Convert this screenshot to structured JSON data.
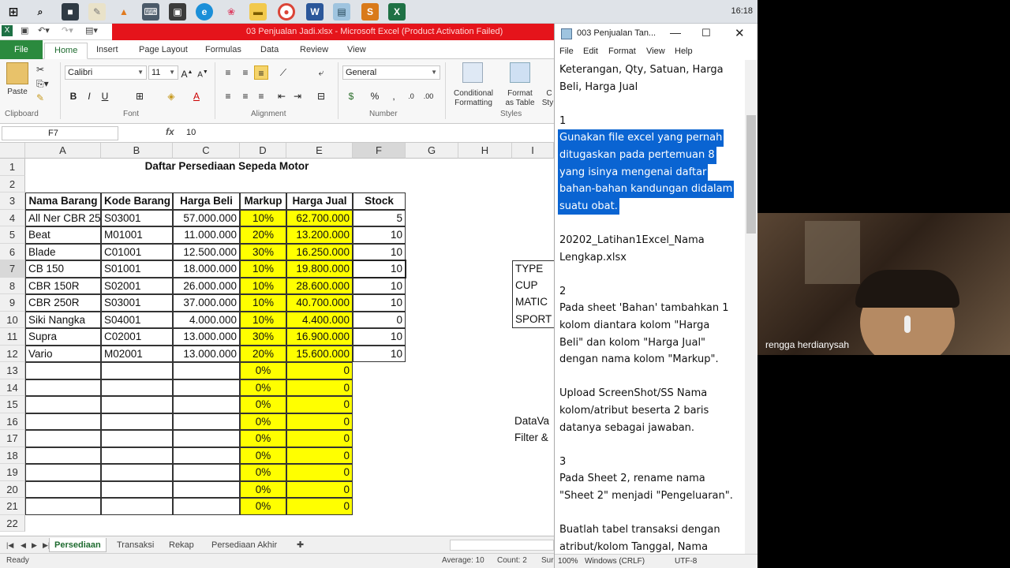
{
  "taskbar": {
    "clock": "16:18"
  },
  "excel": {
    "title": "03 Penjualan Jadi.xlsx  -  Microsoft Excel (Product Activation Failed)",
    "tabs": [
      "File",
      "Home",
      "Insert",
      "Page Layout",
      "Formulas",
      "Data",
      "Review",
      "View"
    ],
    "active_tab": "Home",
    "ribbon": {
      "paste_label": "Paste",
      "clipboard_label": "Clipboard",
      "font_name": "Calibri",
      "font_size": "11",
      "font_label": "Font",
      "alignment_label": "Alignment",
      "number_format": "General",
      "number_label": "Number",
      "conditional_formatting": "Conditional",
      "conditional_formatting_2": "Formatting",
      "format_as_table": "Format",
      "format_as_table_2": "as Table",
      "cell_styles": "C",
      "cell_styles_2": "Sty",
      "styles_label": "Styles"
    },
    "formula_bar": {
      "name_box": "F7",
      "fx": "fx",
      "value": "10"
    },
    "columns": [
      "A",
      "B",
      "C",
      "D",
      "E",
      "F",
      "G",
      "H",
      "I"
    ],
    "title_cell": "Daftar Persediaan Sepeda Motor",
    "headers": [
      "Nama Barang",
      "Kode Barang",
      "Harga Beli",
      "Markup",
      "Harga Jual",
      "Stock"
    ],
    "rows": [
      [
        "All Ner CBR 25",
        "S03001",
        "57.000.000",
        "10%",
        "62.700.000",
        "5"
      ],
      [
        "Beat",
        "M01001",
        "11.000.000",
        "20%",
        "13.200.000",
        "10"
      ],
      [
        "Blade",
        "C01001",
        "12.500.000",
        "30%",
        "16.250.000",
        "10"
      ],
      [
        "CB 150",
        "S01001",
        "18.000.000",
        "10%",
        "19.800.000",
        "10"
      ],
      [
        "CBR 150R",
        "S02001",
        "26.000.000",
        "10%",
        "28.600.000",
        "10"
      ],
      [
        "CBR 250R",
        "S03001",
        "37.000.000",
        "10%",
        "40.700.000",
        "10"
      ],
      [
        "Siki Nangka",
        "S04001",
        "4.000.000",
        "10%",
        "4.400.000",
        "0"
      ],
      [
        "Supra",
        "C02001",
        "13.000.000",
        "30%",
        "16.900.000",
        "10"
      ],
      [
        "Vario",
        "M02001",
        "13.000.000",
        "20%",
        "15.600.000",
        "10"
      ],
      [
        "",
        "",
        "",
        "0%",
        "0",
        ""
      ],
      [
        "",
        "",
        "",
        "0%",
        "0",
        ""
      ],
      [
        "",
        "",
        "",
        "0%",
        "0",
        ""
      ],
      [
        "",
        "",
        "",
        "0%",
        "0",
        ""
      ],
      [
        "",
        "",
        "",
        "0%",
        "0",
        ""
      ],
      [
        "",
        "",
        "",
        "0%",
        "0",
        ""
      ],
      [
        "",
        "",
        "",
        "0%",
        "0",
        ""
      ],
      [
        "",
        "",
        "",
        "0%",
        "0",
        ""
      ],
      [
        "",
        "",
        "",
        "0%",
        "0",
        ""
      ]
    ],
    "type_box": [
      "TYPE",
      "CUP",
      "MATIC",
      "SPORT"
    ],
    "side_notes": [
      "DataVa",
      "Filter &"
    ],
    "row_numbers": [
      "1",
      "2",
      "3",
      "4",
      "5",
      "6",
      "7",
      "8",
      "9",
      "10",
      "11",
      "12",
      "13",
      "14",
      "15",
      "16",
      "17",
      "18",
      "19",
      "20",
      "21",
      "22"
    ],
    "sheet_tabs": [
      "Persediaan",
      "Transaksi",
      "Rekap",
      "Persediaan Akhir"
    ],
    "active_sheet": "Persediaan",
    "status": {
      "ready": "Ready",
      "average": "Average: 10",
      "count": "Count: 2",
      "sum": "Sur"
    }
  },
  "notepad": {
    "title": "003 Penjualan Tan...",
    "menu": [
      "File",
      "Edit",
      "Format",
      "View",
      "Help"
    ],
    "lines": [
      {
        "t": "Keterangan, Qty, Satuan, Harga",
        "hl": false
      },
      {
        "t": "Beli, Harga Jual",
        "hl": false
      },
      {
        "t": "",
        "hl": false
      },
      {
        "t": "1",
        "hl": false
      },
      {
        "t": "Gunakan file excel yang pernah",
        "hl": true
      },
      {
        "t": "ditugaskan pada pertemuan 8",
        "hl": true
      },
      {
        "t": "yang isinya mengenai daftar",
        "hl": true
      },
      {
        "t": "bahan-bahan kandungan didalam",
        "hl": true
      },
      {
        "t": "suatu obat.",
        "hl": true
      },
      {
        "t": "",
        "hl": false
      },
      {
        "t": "20202_Latihan1Excel_Nama",
        "hl": false
      },
      {
        "t": "Lengkap.xlsx",
        "hl": false
      },
      {
        "t": "",
        "hl": false
      },
      {
        "t": "2",
        "hl": false
      },
      {
        "t": "Pada sheet 'Bahan' tambahkan 1",
        "hl": false
      },
      {
        "t": "kolom diantara kolom \"Harga",
        "hl": false
      },
      {
        "t": "Beli\" dan kolom \"Harga Jual\"",
        "hl": false
      },
      {
        "t": "dengan nama kolom \"Markup\".",
        "hl": false
      },
      {
        "t": "",
        "hl": false
      },
      {
        "t": "Upload ScreenShot/SS Nama",
        "hl": false
      },
      {
        "t": "kolom/atribut beserta 2 baris",
        "hl": false
      },
      {
        "t": "datanya sebagai jawaban.",
        "hl": false
      },
      {
        "t": "",
        "hl": false
      },
      {
        "t": "3",
        "hl": false
      },
      {
        "t": "Pada Sheet 2, rename nama",
        "hl": false
      },
      {
        "t": "\"Sheet 2\" menjadi \"Pengeluaran\".",
        "hl": false
      },
      {
        "t": "",
        "hl": false
      },
      {
        "t": "Buatlah tabel transaksi dengan",
        "hl": false
      },
      {
        "t": "atribut/kolom Tanggal, Nama",
        "hl": false
      }
    ],
    "status": {
      "zoom": "100%",
      "eol": "Windows (CRLF)",
      "encoding": "UTF-8"
    }
  },
  "webcam": {
    "name": "rengga herdianysah"
  }
}
